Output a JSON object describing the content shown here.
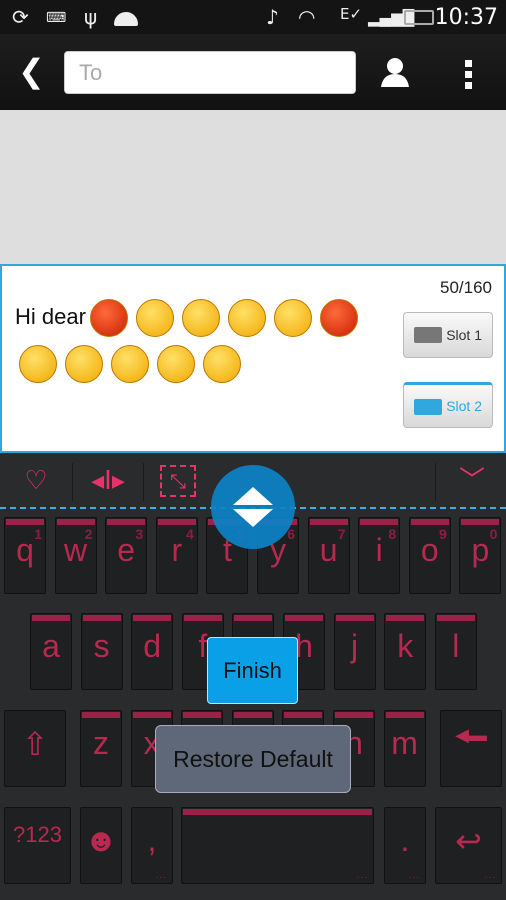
{
  "status_bar": {
    "time": "10:37",
    "icons": [
      "sync-icon",
      "keyboard-icon",
      "usb-icon",
      "android-icon",
      "mute-music-icon",
      "wifi-icon",
      "edge-signal-icon",
      "cell-signal-icon",
      "battery-charging-icon"
    ]
  },
  "action_bar": {
    "to_placeholder": "To",
    "icons": [
      "back-icon",
      "contact-icon",
      "overflow-menu-icon"
    ]
  },
  "compose": {
    "text": "Hi dear",
    "emojis": [
      "angry",
      "grin",
      "tongue",
      "grin",
      "sunglasses",
      "angry",
      "grin",
      "crying",
      "wink",
      "grin",
      "grin"
    ],
    "char_count": "50/160",
    "slots": [
      {
        "label": "Slot 1",
        "active": false
      },
      {
        "label": "Slot 2",
        "active": true
      }
    ]
  },
  "keyboard": {
    "accent": "#b8294f",
    "toolbar": [
      "theme-icon",
      "cursor-icon",
      "resize-icon",
      "collapse-icon"
    ],
    "row1": [
      {
        "k": "q",
        "n": "1"
      },
      {
        "k": "w",
        "n": "2"
      },
      {
        "k": "e",
        "n": "3"
      },
      {
        "k": "r",
        "n": "4"
      },
      {
        "k": "t",
        "n": "5"
      },
      {
        "k": "y",
        "n": "6"
      },
      {
        "k": "u",
        "n": "7"
      },
      {
        "k": "i",
        "n": "8"
      },
      {
        "k": "o",
        "n": "9"
      },
      {
        "k": "p",
        "n": "0"
      }
    ],
    "row2": [
      "a",
      "s",
      "d",
      "f",
      "g",
      "h",
      "j",
      "k",
      "l"
    ],
    "row3": [
      "z",
      "x",
      "c",
      "v",
      "b",
      "n",
      "m"
    ],
    "symbols_label": "?123",
    "comma": ",",
    "period": "."
  },
  "overlay": {
    "finish_label": "Finish",
    "restore_label": "Restore Default"
  }
}
